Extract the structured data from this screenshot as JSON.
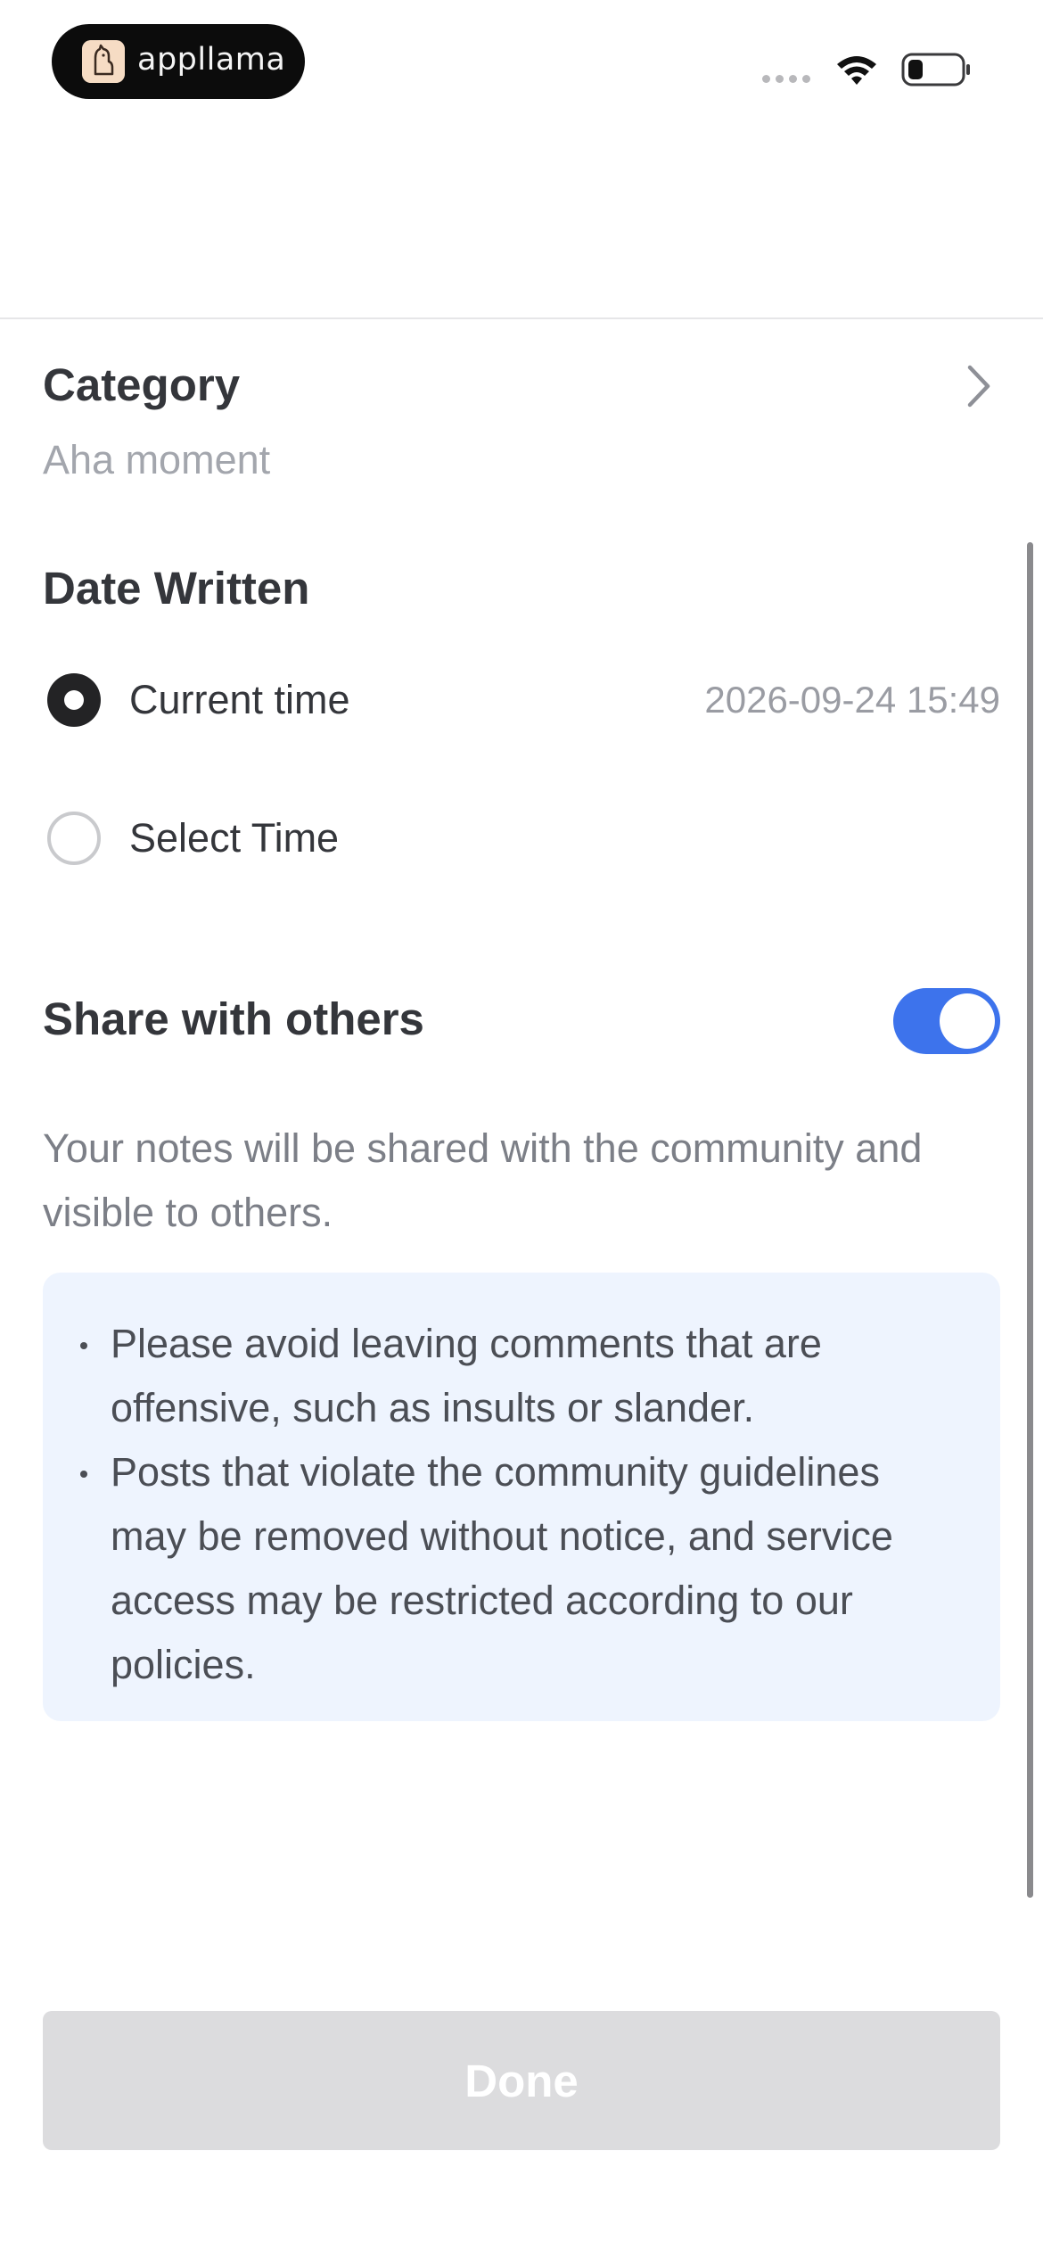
{
  "status_bar": {
    "app_badge_text": "appllama"
  },
  "category": {
    "title": "Category",
    "value": "Aha moment"
  },
  "date_written": {
    "title": "Date Written",
    "options": [
      {
        "label": "Current time",
        "value": "2026-09-24 15:49",
        "selected": true
      },
      {
        "label": "Select Time",
        "selected": false
      }
    ]
  },
  "share": {
    "title": "Share with others",
    "enabled": true,
    "toggle_color": "#3d73ec",
    "description": "Your notes will be shared with the community and visible to others.",
    "notices": [
      "Please avoid leaving comments that are offensive, such as insults or slander.",
      "Posts that violate the community guidelines may be removed without notice, and service access may be restricted according to our policies."
    ]
  },
  "actions": {
    "done_label": "Done",
    "done_enabled": false
  }
}
